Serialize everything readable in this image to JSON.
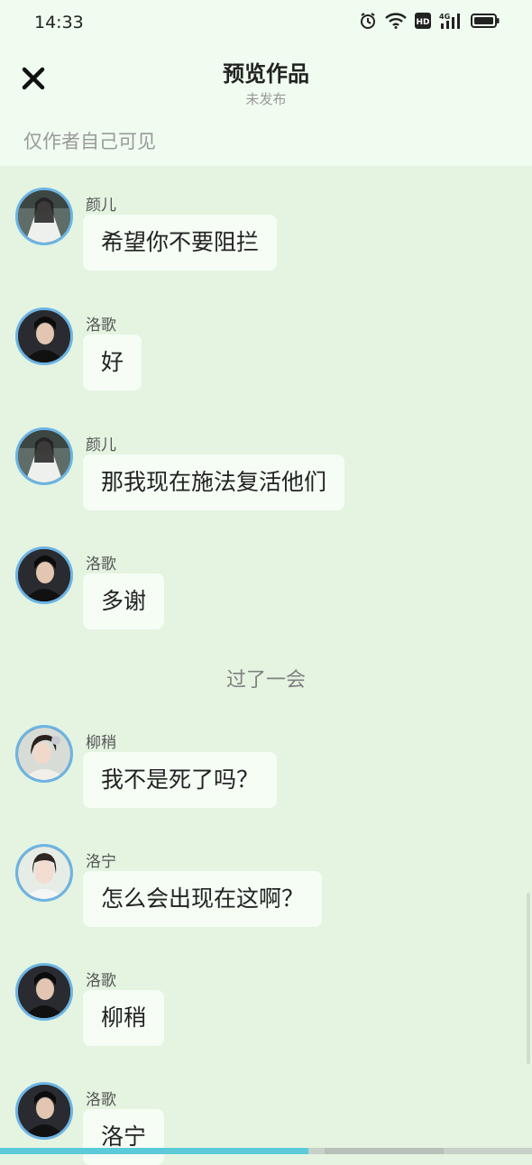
{
  "status": {
    "time": "14:33"
  },
  "header": {
    "title": "预览作品",
    "subtitle": "未发布",
    "visibility_note": "仅作者自己可见"
  },
  "messages": [
    {
      "name": "颜儿",
      "text": "希望你不要阻拦",
      "avatar": "avatar-yaner"
    },
    {
      "name": "洛歌",
      "text": "好",
      "avatar": "avatar-luoge"
    },
    {
      "name": "颜儿",
      "text": "那我现在施法复活他们",
      "avatar": "avatar-yaner"
    },
    {
      "name": "洛歌",
      "text": "多谢",
      "avatar": "avatar-luoge"
    },
    {
      "name": "柳稍",
      "text": "我不是死了吗？",
      "avatar": "avatar-liushao"
    },
    {
      "name": "洛宁",
      "text": "怎么会出现在这啊？",
      "avatar": "avatar-luoning"
    },
    {
      "name": "洛歌",
      "text": "柳稍",
      "avatar": "avatar-luoge"
    },
    {
      "name": "洛歌",
      "text": "洛宁",
      "avatar": "avatar-luoge"
    }
  ],
  "narration": "过了一会",
  "colors": {
    "background": "#e4f4e1",
    "header_bg": "#f0fcf0",
    "bubble": "#f5fdf5",
    "avatar_ring": "#6cb4e4"
  }
}
